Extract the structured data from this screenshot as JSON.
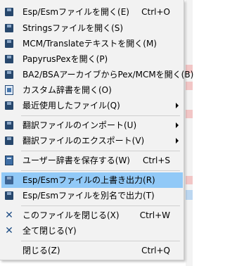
{
  "menu": {
    "items": [
      {
        "label": "Esp/Esmファイルを開く(E)",
        "shortcut": "Ctrl+O",
        "icon": "floppy-icon"
      },
      {
        "label": "Stringsファイルを開く(S)",
        "shortcut": "",
        "icon": "floppy-icon"
      },
      {
        "label": "MCM/Translateテキストを開く(M)",
        "shortcut": "",
        "icon": "floppy-icon"
      },
      {
        "label": "PapyrusPexを開く(P)",
        "shortcut": "",
        "icon": "floppy-icon"
      },
      {
        "label": "BA2/BSAアーカイブからPex/MCMを開く(B)",
        "shortcut": "",
        "icon": "floppy-icon"
      },
      {
        "label": "カスタム辞書を開く(O)",
        "shortcut": "",
        "icon": "calendar-icon"
      },
      {
        "label": "最近使用したファイル(Q)",
        "shortcut": "",
        "icon": "floppy-icon",
        "submenu": true
      },
      {
        "label": "翻訳ファイルのインポート(U)",
        "shortcut": "",
        "icon": "floppy-icon",
        "submenu": true
      },
      {
        "label": "翻訳ファイルのエクスポート(V)",
        "shortcut": "",
        "icon": "floppy-icon",
        "submenu": true
      },
      {
        "label": "ユーザー辞書を保存する(W)",
        "shortcut": "Ctrl+S",
        "icon": "book-icon"
      },
      {
        "label": "Esp/Esmファイルの上書き出力(R)",
        "shortcut": "",
        "icon": "floppy-icon",
        "highlighted": true
      },
      {
        "label": "Esp/Esmファイルを別名で出力(T)",
        "shortcut": "",
        "icon": "floppy-icon"
      },
      {
        "label": "このファイルを閉じる(X)",
        "shortcut": "Ctrl+W",
        "icon": "close-icon"
      },
      {
        "label": "全て閉じる(Y)",
        "shortcut": "",
        "icon": "close-icon"
      },
      {
        "label": "閉じる(Z)",
        "shortcut": "Ctrl+Q",
        "icon": "none"
      }
    ]
  },
  "colors": {
    "menu_background": "#f2f2f2",
    "highlight": "#91c9f7",
    "icon_blue": "#27476c"
  }
}
